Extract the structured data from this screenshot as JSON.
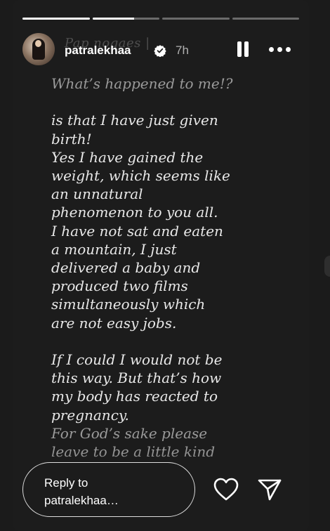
{
  "story": {
    "progress": [
      1.0,
      0.62,
      0.0,
      0.0
    ],
    "header": {
      "faded_caption": "Pap nogaes |",
      "username": "patralekhaa",
      "time": "7h"
    },
    "text_lines": [
      {
        "text": "What’s happened to me!?",
        "dim": true
      },
      {
        "text": "",
        "dim": false
      },
      {
        "text": "is that I have just given",
        "dim": false
      },
      {
        "text": "birth!",
        "dim": false
      },
      {
        "text": "Yes I have gained the",
        "dim": false
      },
      {
        "text": "weight, which seems like",
        "dim": false
      },
      {
        "text": "an unnatural",
        "dim": false
      },
      {
        "text": "phenomenon to you all.",
        "dim": false
      },
      {
        "text": "I have not sat and eaten",
        "dim": false
      },
      {
        "text": "a mountain, I just",
        "dim": false
      },
      {
        "text": "delivered a baby and",
        "dim": false
      },
      {
        "text": "produced two films",
        "dim": false
      },
      {
        "text": "simultaneously which",
        "dim": false
      },
      {
        "text": "are not easy jobs.",
        "dim": false
      },
      {
        "text": "",
        "dim": false
      },
      {
        "text": "If I could I would not be",
        "dim": false
      },
      {
        "text": "this way. But that’s how",
        "dim": false
      },
      {
        "text": "my body has reacted to",
        "dim": false
      },
      {
        "text": "pregnancy.",
        "dim": false
      },
      {
        "text": "For God’s sake please",
        "dim": true
      },
      {
        "text": "leave to be a little kind",
        "dim": true
      }
    ],
    "reply": {
      "line1": "Reply to",
      "line2": "patralekhaa…"
    },
    "icons": {
      "verified": "verified-badge-icon",
      "pause": "pause-icon",
      "more": "more-options-icon",
      "like": "heart-icon",
      "share": "send-icon"
    }
  }
}
